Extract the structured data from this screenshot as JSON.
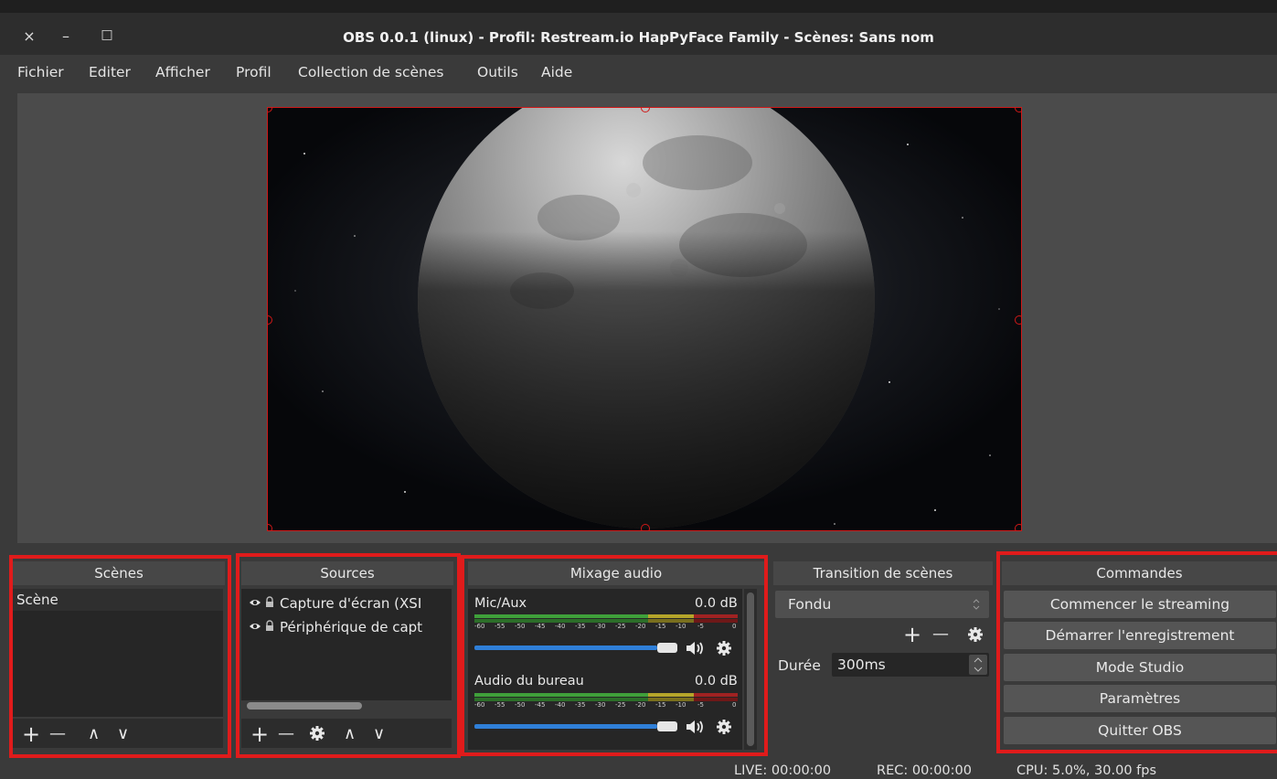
{
  "window": {
    "title": "OBS 0.0.1 (linux) - Profil: Restream.io HapPyFace Family - Scènes: Sans nom",
    "close_glyph": "×",
    "minimize_glyph": "–",
    "maximize_glyph": "□"
  },
  "menu": [
    {
      "label": "Fichier"
    },
    {
      "label": "Editer"
    },
    {
      "label": "Afficher"
    },
    {
      "label": "Profil"
    },
    {
      "label": "Collection de scènes"
    },
    {
      "label": "Outils"
    },
    {
      "label": "Aide"
    }
  ],
  "scenes": {
    "title": "Scènes",
    "items": [
      "Scène"
    ]
  },
  "sources": {
    "title": "Sources",
    "items": [
      "Capture d'écran (XSI",
      "Périphérique de capt"
    ]
  },
  "mixer": {
    "title": "Mixage audio",
    "channels": [
      {
        "name": "Mic/Aux",
        "db": "0.0 dB",
        "volume": 1.0
      },
      {
        "name": "Audio du bureau",
        "db": "0.0 dB",
        "volume": 1.0
      }
    ],
    "ticks": [
      "-60",
      "-55",
      "-50",
      "-45",
      "-40",
      "-35",
      "-30",
      "-25",
      "-20",
      "-15",
      "-10",
      "-5",
      "0"
    ]
  },
  "transition": {
    "title": "Transition de scènes",
    "selected": "Fondu",
    "duration_label": "Durée",
    "duration_value": "300ms"
  },
  "controls": {
    "title": "Commandes",
    "buttons": [
      "Commencer le streaming",
      "Démarrer l'enregistrement",
      "Mode Studio",
      "Paramètres",
      "Quitter OBS"
    ]
  },
  "status": {
    "live": "LIVE: 00:00:00",
    "rec": "REC: 00:00:00",
    "cpu": "CPU: 5.0%, 30.00 fps"
  },
  "icons": {
    "add": "+",
    "remove": "—",
    "up": "∧",
    "down": "∨",
    "eye": "eye-icon",
    "lock": "lock-icon",
    "gear": "gear-icon",
    "speaker": "speaker-icon"
  },
  "colors": {
    "highlight_border": "#e01b1b",
    "preview_border": "#d01818",
    "volume_slider": "#2f7fd8"
  }
}
